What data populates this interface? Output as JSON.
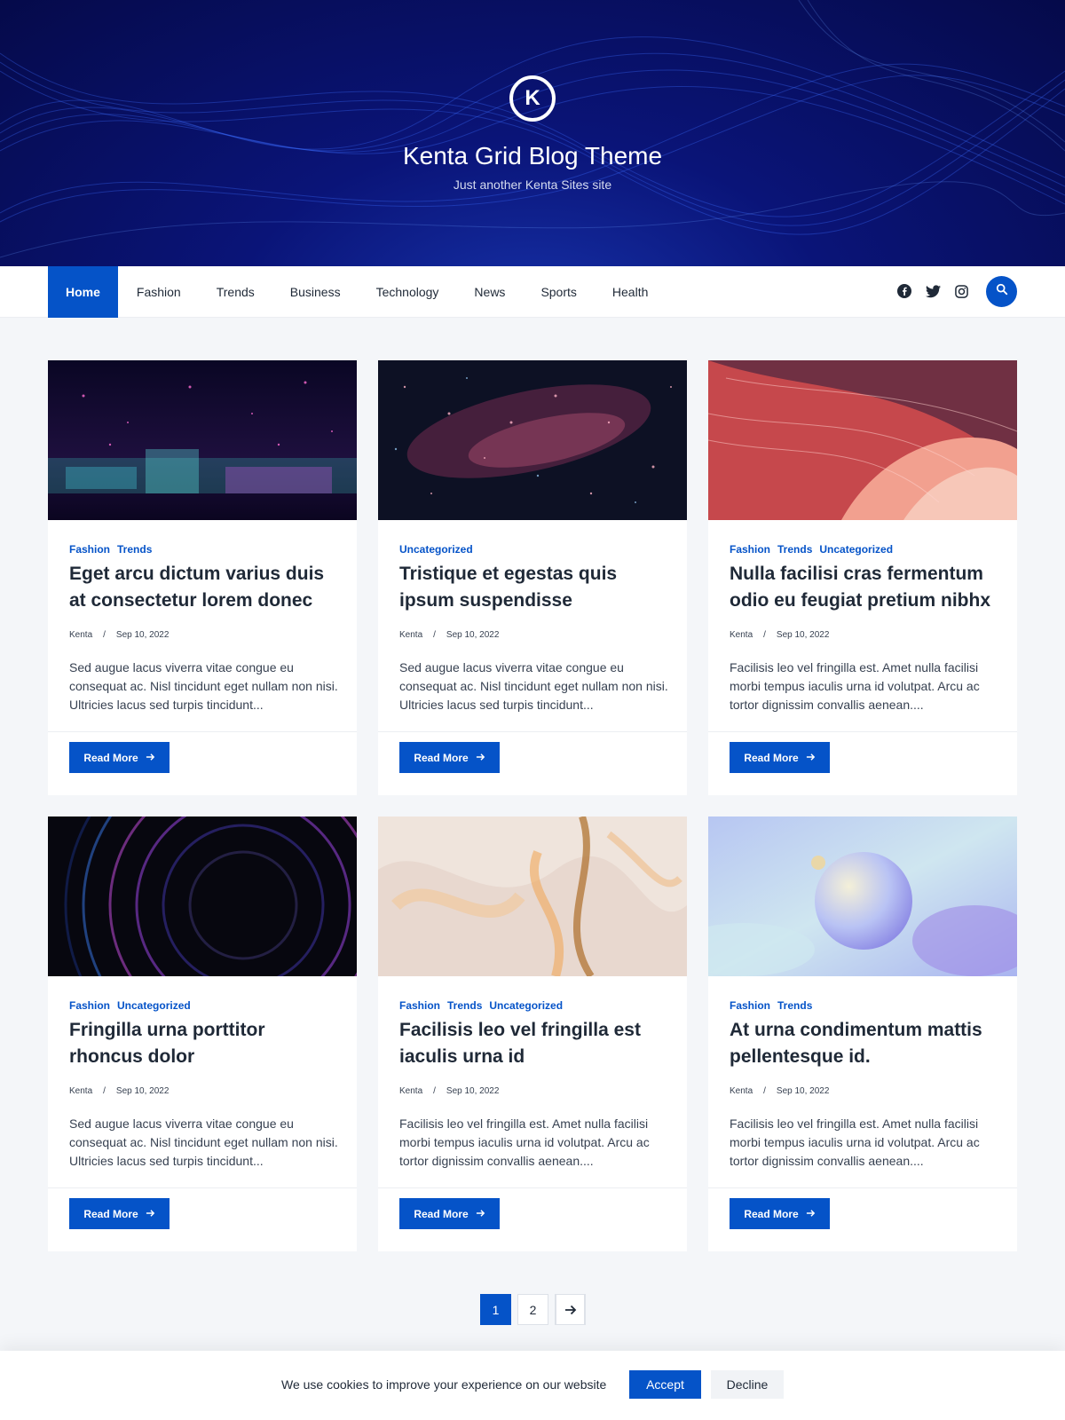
{
  "site": {
    "logo_letter": "K",
    "title": "Kenta Grid Blog Theme",
    "tagline": "Just another Kenta Sites site"
  },
  "nav": {
    "items": [
      "Home",
      "Fashion",
      "Trends",
      "Business",
      "Technology",
      "News",
      "Sports",
      "Health"
    ],
    "active": "Home",
    "social_icons": [
      "facebook-icon",
      "twitter-icon",
      "instagram-icon"
    ],
    "search_icon": "search-icon"
  },
  "posts": [
    {
      "categories": [
        "Fashion",
        "Trends"
      ],
      "title": "Eget arcu dictum varius duis at consectetur lorem donec",
      "author": "Kenta",
      "separator": "/",
      "date": "Sep 10, 2022",
      "excerpt": "Sed augue lacus viverra vitae congue eu consequat ac. Nisl tincidunt eget nullam non nisi. Ultricies lacus sed turpis tincidunt...",
      "button": "Read More"
    },
    {
      "categories": [
        "Uncategorized"
      ],
      "title": "Tristique et egestas quis ipsum suspendisse",
      "author": "Kenta",
      "separator": "/",
      "date": "Sep 10, 2022",
      "excerpt": "Sed augue lacus viverra vitae congue eu consequat ac. Nisl tincidunt eget nullam non nisi. Ultricies lacus sed turpis tincidunt...",
      "button": "Read More"
    },
    {
      "categories": [
        "Fashion",
        "Trends",
        "Uncategorized"
      ],
      "title": "Nulla facilisi cras fermentum odio eu feugiat pretium nibhx",
      "author": "Kenta",
      "separator": "/",
      "date": "Sep 10, 2022",
      "excerpt": "Facilisis leo vel fringilla est. Amet nulla facilisi morbi tempus iaculis urna id volutpat. Arcu ac tortor dignissim convallis aenean....",
      "button": "Read More"
    },
    {
      "categories": [
        "Fashion",
        "Uncategorized"
      ],
      "title": "Fringilla urna porttitor rhoncus dolor",
      "author": "Kenta",
      "separator": "/",
      "date": "Sep 10, 2022",
      "excerpt": "Sed augue lacus viverra vitae congue eu consequat ac. Nisl tincidunt eget nullam non nisi. Ultricies lacus sed turpis tincidunt...",
      "button": "Read More"
    },
    {
      "categories": [
        "Fashion",
        "Trends",
        "Uncategorized"
      ],
      "title": "Facilisis leo vel fringilla est iaculis urna id",
      "author": "Kenta",
      "separator": "/",
      "date": "Sep 10, 2022",
      "excerpt": "Facilisis leo vel fringilla est. Amet nulla facilisi morbi tempus iaculis urna id volutpat. Arcu ac tortor dignissim convallis aenean....",
      "button": "Read More"
    },
    {
      "categories": [
        "Fashion",
        "Trends"
      ],
      "title": "At urna condimentum mattis pellentesque id.",
      "author": "Kenta",
      "separator": "/",
      "date": "Sep 10, 2022",
      "excerpt": "Facilisis leo vel fringilla est. Amet nulla facilisi morbi tempus iaculis urna id volutpat. Arcu ac tortor dignissim convallis aenean....",
      "button": "Read More"
    }
  ],
  "pagination": {
    "pages": [
      "1",
      "2"
    ],
    "current": "1",
    "next_icon": "arrow-right-icon"
  },
  "cookie": {
    "message": "We use cookies to improve your experience on our website",
    "accept": "Accept",
    "decline": "Decline"
  },
  "colors": {
    "accent": "#0553c8",
    "header_bg": "#0a1478",
    "page_bg": "#f4f6f9"
  }
}
